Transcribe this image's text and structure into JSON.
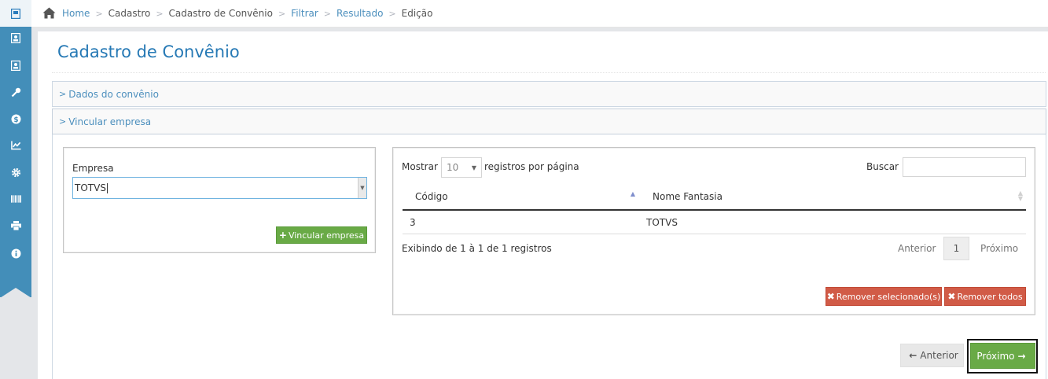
{
  "sidebar": {
    "items": [
      {
        "icon": "book-icon",
        "active": true
      },
      {
        "icon": "contact-card-icon"
      },
      {
        "icon": "contact-card-icon"
      },
      {
        "icon": "key-icon"
      },
      {
        "icon": "dollar-circle-icon"
      },
      {
        "icon": "line-chart-icon"
      },
      {
        "icon": "gear-icon"
      },
      {
        "icon": "barcode-icon"
      },
      {
        "icon": "printer-icon"
      },
      {
        "icon": "info-circle-icon"
      }
    ],
    "color": "#438eb9"
  },
  "breadcrumbs": {
    "home": "Home",
    "cadastro": "Cadastro",
    "cadastro_convenio": "Cadastro de Convênio",
    "filtrar": "Filtrar",
    "resultado": "Resultado",
    "edicao": "Edição"
  },
  "page": {
    "title": "Cadastro de Convênio"
  },
  "accordion": {
    "dados": "Dados do convênio",
    "vincular": "Vincular empresa"
  },
  "form": {
    "empresa_label": "Empresa",
    "empresa_value": "TOTVS",
    "vincular_button": "Vincular empresa"
  },
  "table": {
    "show_prefix": "Mostrar",
    "page_size": "10",
    "show_suffix": "registros por página",
    "search_label": "Buscar",
    "search_value": "",
    "columns": [
      "Código",
      "Nome Fantasia"
    ],
    "rows": [
      {
        "codigo": "3",
        "nome": "TOTVS"
      }
    ],
    "info": "Exibindo de 1 à 1 de 1 registros",
    "pager": {
      "prev": "Anterior",
      "current": "1",
      "next": "Próximo"
    },
    "remove_selected": "Remover selecionado(s)",
    "remove_all": "Remover todos"
  },
  "nav": {
    "anterior": "Anterior",
    "proximo": "Próximo"
  },
  "colors": {
    "primary_blue": "#438eb9",
    "title_blue": "#2679b5",
    "link_blue": "#4c8fbd",
    "success": "#69aa46",
    "danger": "#d15b47"
  }
}
